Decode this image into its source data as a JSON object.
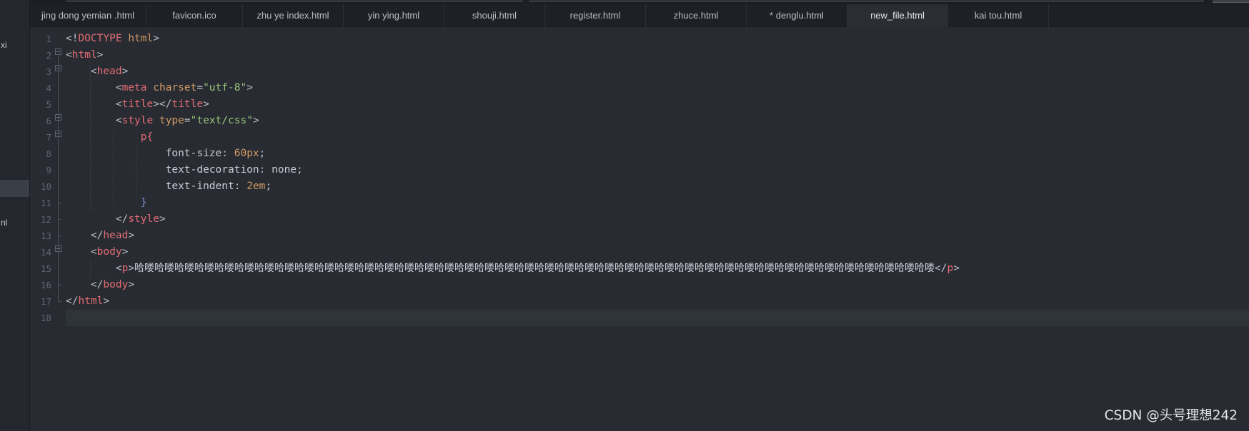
{
  "sidebar": {
    "snippet_top": "xi",
    "snippet_bottom": "nl"
  },
  "tabs": [
    {
      "label": "jing  dong yemian .html",
      "active": false
    },
    {
      "label": "favicon.ico",
      "active": false
    },
    {
      "label": "zhu ye index.html",
      "active": false
    },
    {
      "label": "yin ying.html",
      "active": false
    },
    {
      "label": "shouji.html",
      "active": false
    },
    {
      "label": "register.html",
      "active": false
    },
    {
      "label": "zhuce.html",
      "active": false
    },
    {
      "label": "* denglu.html",
      "active": false
    },
    {
      "label": "new_file.html",
      "active": true
    },
    {
      "label": "kai tou.html",
      "active": false
    }
  ],
  "editor": {
    "current_line": 18,
    "line_numbers": [
      "1",
      "2",
      "3",
      "4",
      "5",
      "6",
      "7",
      "8",
      "9",
      "10",
      "11",
      "12",
      "13",
      "14",
      "15",
      "16",
      "17",
      "18"
    ],
    "lines": {
      "l1": {
        "open": "<!",
        "doctype": "DOCTYPE",
        "html": "html",
        "close": ">"
      },
      "l2": {
        "open": "<",
        "tag": "html",
        "close": ">"
      },
      "l3": {
        "open": "<",
        "tag": "head",
        "close": ">"
      },
      "l4": {
        "open": "<",
        "tag": "meta",
        "attr": "charset",
        "eq": "=",
        "value": "\"utf-8\"",
        "close": ">"
      },
      "l5": {
        "open1": "<",
        "tag1": "title",
        "mid": "></",
        "tag2": "title",
        "close": ">"
      },
      "l6": {
        "open": "<",
        "tag": "style",
        "attr": "type",
        "eq": "=",
        "value": "\"text/css\"",
        "close": ">"
      },
      "l7": {
        "selector": "p",
        "brace": "{"
      },
      "l8": {
        "prop": "font-size",
        "colon": ": ",
        "value": "60px",
        "semi": ";"
      },
      "l9": {
        "prop": "text-decoration",
        "colon": ": ",
        "value": "none",
        "semi": ";"
      },
      "l10": {
        "prop": "text-indent",
        "colon": ": ",
        "value": "2em",
        "semi": ";"
      },
      "l11": {
        "brace": "}"
      },
      "l12": {
        "open": "</",
        "tag": "style",
        "close": ">"
      },
      "l13": {
        "open": "</",
        "tag": "head",
        "close": ">"
      },
      "l14": {
        "open": "<",
        "tag": "body",
        "close": ">"
      },
      "l15": {
        "open1": "<",
        "tag1": "p",
        "close1": ">",
        "text": "哈喽哈喽哈喽哈喽哈喽哈喽哈喽哈喽哈喽哈喽哈喽哈喽哈喽哈喽哈喽哈喽哈喽哈喽哈喽哈喽哈喽哈喽哈喽哈喽哈喽哈喽哈喽哈喽哈喽哈喽哈喽哈喽哈喽哈喽哈喽哈喽哈喽哈喽哈喽哈喽",
        "open2": "</",
        "tag2": "p",
        "close2": ">"
      },
      "l16": {
        "open": "</",
        "tag": "body",
        "close": ">"
      },
      "l17": {
        "open": "</",
        "tag": "html",
        "close": ">"
      }
    }
  },
  "watermark": "CSDN @头号理想242",
  "colors": {
    "tag": "#e06c75",
    "attribute": "#d19a66",
    "string": "#98c379",
    "background": "#282b31"
  }
}
